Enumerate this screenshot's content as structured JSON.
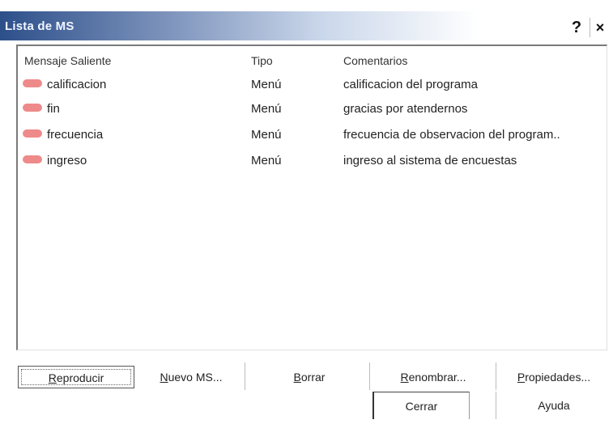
{
  "window": {
    "title": "Lista de MS",
    "help_label": "?",
    "close_label": "×"
  },
  "list": {
    "columns": [
      "Mensaje Saliente",
      "Tipo",
      "Comentarios"
    ],
    "rows": [
      {
        "name": "calificacion",
        "type": "Menú",
        "comment": "calificacion del programa"
      },
      {
        "name": "fin",
        "type": "Menú",
        "comment": "gracias por atendernos"
      },
      {
        "name": "frecuencia",
        "type": "Menú",
        "comment": "frecuencia de observacion del program.."
      },
      {
        "name": "ingreso",
        "type": "Menú",
        "comment": "ingreso al sistema de encuestas"
      }
    ]
  },
  "buttons": {
    "reproducir": {
      "mnemonic": "R",
      "rest": "eproducir"
    },
    "nuevo": {
      "mnemonic": "N",
      "rest": "uevo MS..."
    },
    "borrar": {
      "mnemonic": "B",
      "rest": "orrar"
    },
    "renombrar": {
      "mnemonic": "R",
      "rest": "enombrar..."
    },
    "propiedades": {
      "mnemonic": "P",
      "rest": "ropiedades..."
    },
    "cerrar": "Cerrar",
    "ayuda": "Ayuda"
  },
  "colors": {
    "title_bar_start": "#2d4f8a",
    "item_icon": "#ef8a8a"
  },
  "icons": {
    "item": "message-pill-icon",
    "help": "help-icon",
    "close": "close-icon"
  }
}
